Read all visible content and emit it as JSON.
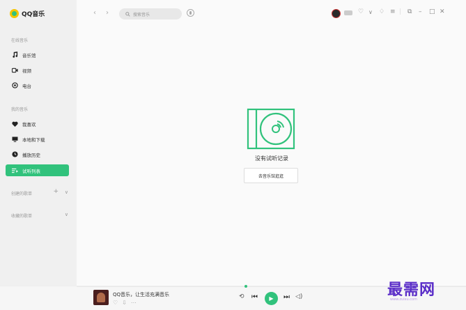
{
  "app": {
    "name": "QQ音乐"
  },
  "sidebar": {
    "sections": [
      {
        "label": "在线音乐"
      },
      {
        "label": "我的音乐"
      },
      {
        "label": "创建的歌单"
      },
      {
        "label": "收藏的歌单"
      }
    ],
    "items": [
      {
        "label": "音乐馆",
        "icon": "music-note-icon"
      },
      {
        "label": "视频",
        "icon": "video-icon"
      },
      {
        "label": "电台",
        "icon": "radio-icon"
      },
      {
        "label": "我喜欢",
        "icon": "heart-icon"
      },
      {
        "label": "本地和下载",
        "icon": "computer-icon"
      },
      {
        "label": "播放历史",
        "icon": "clock-icon"
      },
      {
        "label": "试听列表",
        "icon": "playlist-icon",
        "active": true
      }
    ]
  },
  "topbar": {
    "search_placeholder": "搜索音乐"
  },
  "main": {
    "empty_text": "没有试听记录",
    "go_button": "去音乐馆逛逛"
  },
  "player": {
    "song_title": "QQ音乐，让生活充满音乐"
  },
  "watermark": {
    "text": "最需网",
    "sub": "www.zuixu.com"
  },
  "colors": {
    "accent": "#31c27c",
    "watermark": "#5a2dc8"
  }
}
